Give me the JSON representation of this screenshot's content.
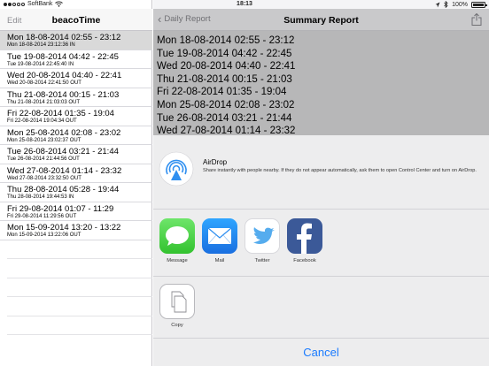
{
  "status_bar": {
    "carrier": "SoftBank",
    "time": "18:13",
    "battery_percent": "100%"
  },
  "left_pane": {
    "edit_label": "Edit",
    "title": "beacoTime",
    "rows": [
      {
        "main": "Mon 18-08-2014 02:55 - 23:12",
        "sub": "Mon 18-08-2014 23:12:36 IN",
        "selected": true
      },
      {
        "main": "Tue 19-08-2014 04:42 - 22:45",
        "sub": "Tue 19-08-2014 22:45:40 IN",
        "selected": false
      },
      {
        "main": "Wed 20-08-2014 04:40 - 22:41",
        "sub": "Wed 20-08-2014 22:41:50 OUT",
        "selected": false
      },
      {
        "main": "Thu 21-08-2014 00:15 - 21:03",
        "sub": "Thu 21-08-2014 21:03:03 OUT",
        "selected": false
      },
      {
        "main": "Fri 22-08-2014 01:35 - 19:04",
        "sub": "Fri 22-08-2014 19:04:34 OUT",
        "selected": false
      },
      {
        "main": "Mon 25-08-2014 02:08 - 23:02",
        "sub": "Mon 25-08-2014 23:02:37 OUT",
        "selected": false
      },
      {
        "main": "Tue 26-08-2014 03:21 - 21:44",
        "sub": "Tue 26-08-2014 21:44:56 OUT",
        "selected": false
      },
      {
        "main": "Wed 27-08-2014 01:14 - 23:32",
        "sub": "Wed 27-08-2014 23:32:50 OUT",
        "selected": false
      },
      {
        "main": "Thu 28-08-2014 05:28 - 19:44",
        "sub": "Thu 28-08-2014 19:44:53 IN",
        "selected": false
      },
      {
        "main": "Fri 29-08-2014 01:07 - 11:29",
        "sub": "Fri 29-08-2014 11:29:56 OUT",
        "selected": false
      },
      {
        "main": "Mon 15-09-2014 13:20 - 13:22",
        "sub": "Mon 15-09-2014 13:22:06 OUT",
        "selected": false
      }
    ]
  },
  "right_pane": {
    "back_label": "Daily Report",
    "title": "Summary Report",
    "report_lines": [
      "Mon 18-08-2014 02:55 - 23:12",
      "Tue 19-08-2014 04:42 - 22:45",
      "Wed 20-08-2014 04:40 - 22:41",
      "Thu 21-08-2014 00:15 - 21:03",
      "Fri 22-08-2014 01:35 - 19:04",
      "Mon 25-08-2014 02:08 - 23:02",
      "Tue 26-08-2014 03:21 - 21:44",
      "Wed 27-08-2014 01:14 - 23:32"
    ]
  },
  "share_sheet": {
    "airdrop": {
      "title": "AirDrop",
      "description": "Share instantly with people nearby. If they do not appear automatically, ask them to open Control Center and turn on AirDrop."
    },
    "apps": [
      {
        "label": "Message",
        "icon": "message-icon",
        "color": "#4cd964"
      },
      {
        "label": "Mail",
        "icon": "mail-icon",
        "color": "#1d8cf0"
      },
      {
        "label": "Twitter",
        "icon": "twitter-icon",
        "color": "#55acee"
      },
      {
        "label": "Facebook",
        "icon": "facebook-icon",
        "color": "#3b5998"
      }
    ],
    "actions": [
      {
        "label": "Copy",
        "icon": "copy-icon"
      }
    ],
    "cancel_label": "Cancel"
  },
  "colors": {
    "accent": "#1a7bff",
    "selected_row": "#d9d9d9",
    "report_background": "#b7b7b8"
  }
}
